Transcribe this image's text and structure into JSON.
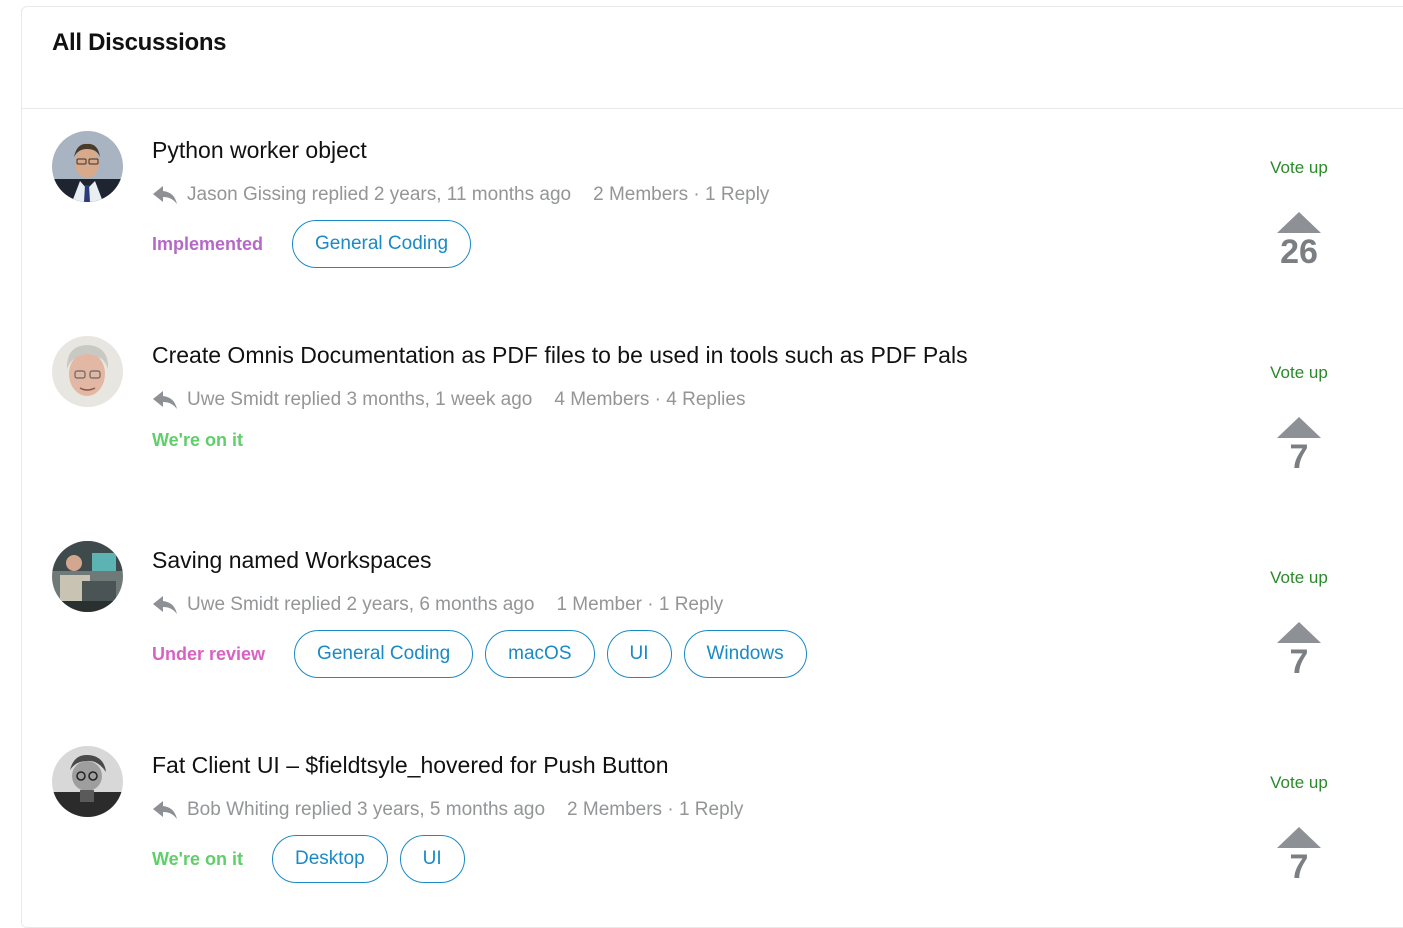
{
  "page": {
    "title": "All Discussions"
  },
  "colors": {
    "status_implemented": "#b469c7",
    "status_on_it": "#5fcf6a",
    "status_review": "#d961c4",
    "tag": "#1a8ac5",
    "vote_label": "#2a8a2a",
    "vote_arrow": "#8d9094"
  },
  "discussions": [
    {
      "title": "Python worker object",
      "author_line": "Jason Gissing replied 2 years, 11 months ago",
      "counts": "2 Members · 1 Reply",
      "status": "Implemented",
      "tags": [
        "General Coding"
      ],
      "vote_label": "Vote up",
      "votes": "26",
      "avatar_icon": "avatar-photo-icon"
    },
    {
      "title": "Create Omnis Documentation as PDF files to be used in tools such as PDF Pals",
      "author_line": "Uwe Smidt replied 3 months, 1 week ago",
      "counts": "4 Members · 4 Replies",
      "status": "We're on it",
      "tags": [],
      "vote_label": "Vote up",
      "votes": "7",
      "avatar_icon": "avatar-photo-icon"
    },
    {
      "title": "Saving named Workspaces",
      "author_line": "Uwe Smidt replied 2 years, 6 months ago",
      "counts": "1 Member · 1 Reply",
      "status": "Under review",
      "tags": [
        "General Coding",
        "macOS",
        "UI",
        "Windows"
      ],
      "vote_label": "Vote up",
      "votes": "7",
      "avatar_icon": "avatar-photo-icon"
    },
    {
      "title": "Fat Client UI – $fieldtsyle_hovered for Push Button",
      "author_line": "Bob Whiting replied 3 years, 5 months ago",
      "counts": "2 Members · 1 Reply",
      "status": "We're on it",
      "tags": [
        "Desktop",
        "UI"
      ],
      "vote_label": "Vote up",
      "votes": "7",
      "avatar_icon": "avatar-photo-icon"
    }
  ]
}
